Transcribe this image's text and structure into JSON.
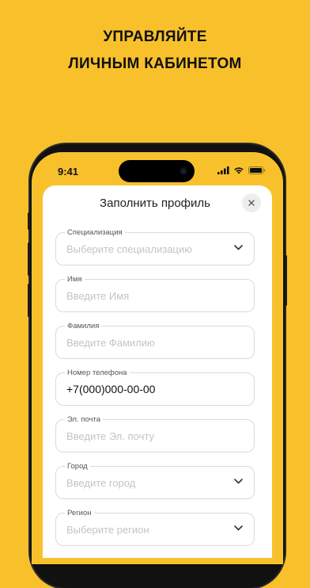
{
  "promo": {
    "line1": "УПРАВЛЯЙТЕ",
    "line2": "ЛИЧНЫМ КАБИНЕТОМ"
  },
  "status_bar": {
    "time": "9:41"
  },
  "sheet": {
    "title": "Заполнить профиль"
  },
  "form": {
    "fields": [
      {
        "label": "Специализация",
        "placeholder": "Выберите специализацию",
        "dropdown": true
      },
      {
        "label": "Имя",
        "placeholder": "Введите Имя",
        "dropdown": false
      },
      {
        "label": "Фамилия",
        "placeholder": "Введите Фамилию",
        "dropdown": false
      },
      {
        "label": "Номер телефона",
        "value": "+7(000)000-00-00",
        "dropdown": false
      },
      {
        "label": "Эл. почта",
        "placeholder": "Введите Эл. почту",
        "dropdown": false
      },
      {
        "label": "Город",
        "placeholder": "Введите город",
        "dropdown": true
      },
      {
        "label": "Регион",
        "placeholder": "Выберите регион",
        "dropdown": true
      }
    ]
  },
  "colors": {
    "background": "#F8C12C",
    "sheet": "#FFFFFF",
    "border": "#DADADA",
    "placeholder": "#C4C4C4"
  },
  "icons": [
    "close-icon",
    "chevron-down-icon",
    "signal-icon",
    "wifi-icon",
    "battery-icon"
  ]
}
